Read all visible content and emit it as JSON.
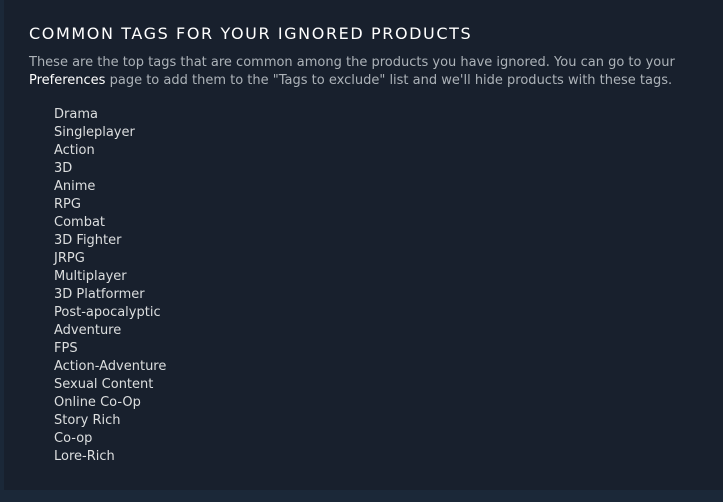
{
  "section": {
    "title": "COMMON TAGS FOR YOUR IGNORED PRODUCTS",
    "description_part1": "These are the top tags that are common among the products you have ignored. You can go to your ",
    "preferences_link": "Preferences",
    "description_part2": " page to add them to the \"Tags to exclude\" list and we'll hide products with these tags."
  },
  "tags": [
    "Drama",
    "Singleplayer",
    "Action",
    "3D",
    "Anime",
    "RPG",
    "Combat",
    "3D Fighter",
    "JRPG",
    "Multiplayer",
    "3D Platformer",
    "Post-apocalyptic",
    "Adventure",
    "FPS",
    "Action-Adventure",
    "Sexual Content",
    "Online Co-Op",
    "Story Rich",
    "Co-op",
    "Lore-Rich"
  ],
  "colors": {
    "background": "#1b2838",
    "panel": "#18202d",
    "title": "#ffffff",
    "description": "#acb2b8",
    "link": "#ffffff",
    "tag_text": "#dcdedf"
  }
}
